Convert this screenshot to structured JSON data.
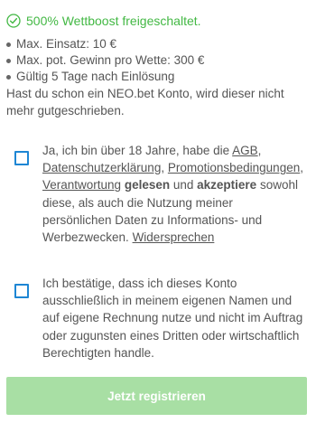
{
  "promo": {
    "text": "500% Wettboost freigeschaltet."
  },
  "bullets": [
    "Max. Einsatz: 10 €",
    "Max. pot. Gewinn pro Wette: 300 €",
    "Gültig 5 Tage nach Einlösung"
  ],
  "note": "Hast du schon ein NEO.bet Konto, wird dieser nicht mehr gutgeschrieben.",
  "consent_age": {
    "prefix": "Ja, ich bin über 18 Jahre, habe die ",
    "link_agb": "AGB",
    "sep1": ",",
    "link_privacy": "Datenschutzerklärung",
    "sep2": ",",
    "link_promo": "Promotionsbedingungen",
    "sep3": ", ",
    "link_responsibility": "Verantwortung",
    "bold_read": "gelesen",
    "and": " und ",
    "bold_accept": "akzeptiere",
    "rest": " sowohl diese, als auch die Nutzung meiner persönlichen Daten zu Informations- und Werbezwecken.",
    "link_revoke": "Widersprechen"
  },
  "consent_account": {
    "text": "Ich bestätige, dass ich dieses Konto ausschließlich in meinem eigenen Namen und auf eigene Rechnung nutze und nicht im Auftrag oder zugunsten eines Dritten oder wirtschaftlich Berechtigten handle."
  },
  "register_button": {
    "label": "Jetzt registrieren"
  },
  "colors": {
    "promo_green": "#43b844",
    "checkbox_blue": "#1e86d4",
    "button_green": "#a8dfa4",
    "text_gray": "#555555"
  }
}
